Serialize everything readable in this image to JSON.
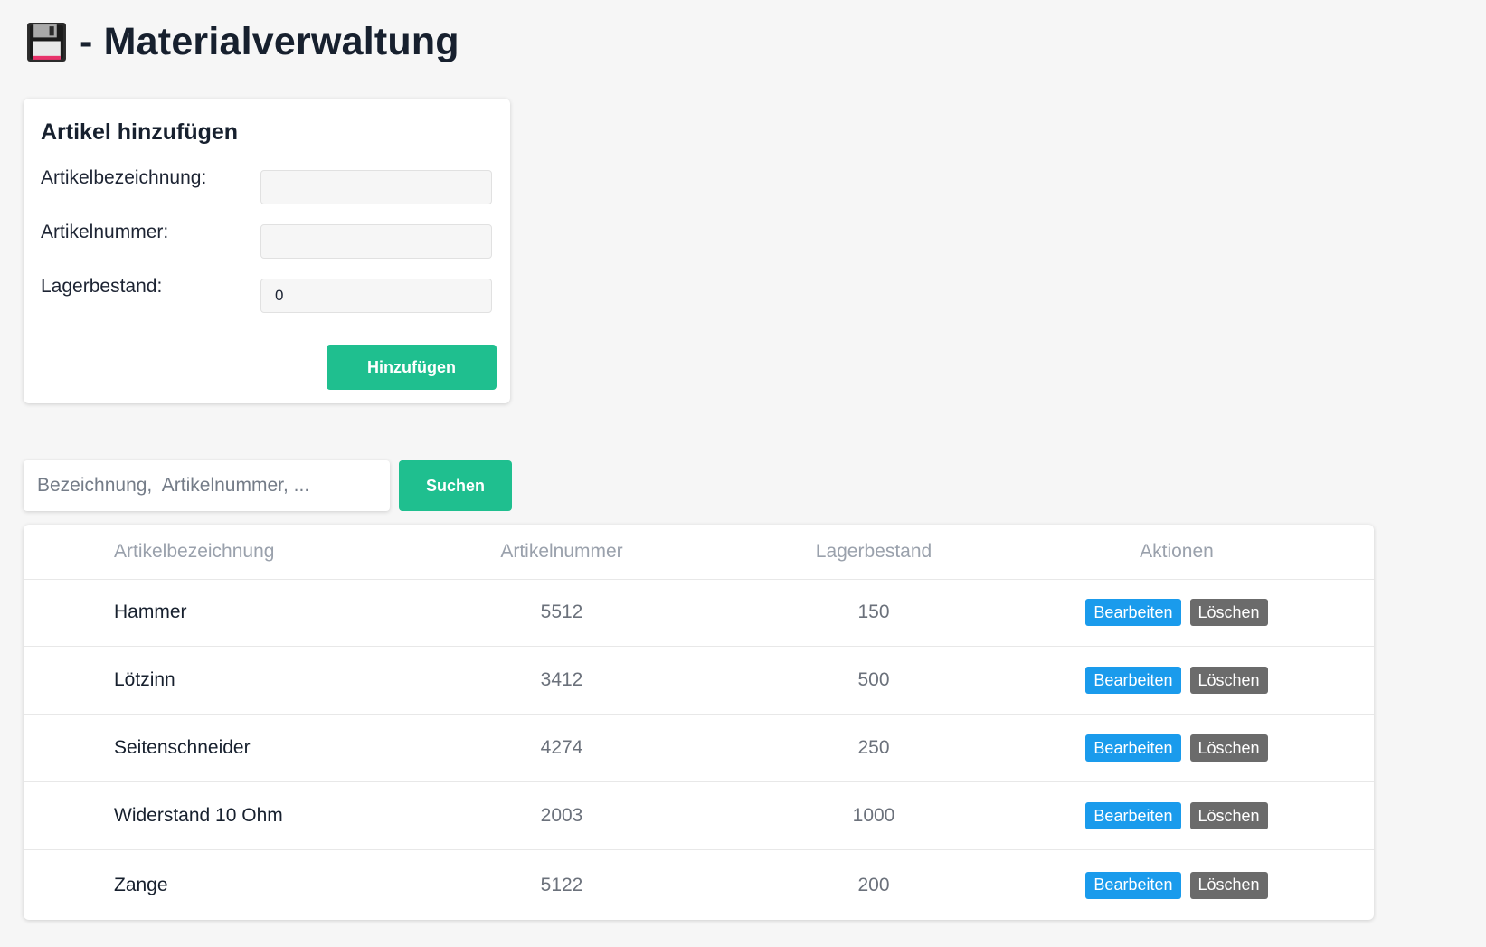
{
  "header": {
    "icon": "floppy-disk-icon",
    "title": "- Materialverwaltung"
  },
  "add_form": {
    "title": "Artikel hinzufügen",
    "fields": [
      {
        "label": "Artikelbezeichnung:",
        "value": "",
        "placeholder": ""
      },
      {
        "label": "Artikelnummer:",
        "value": "",
        "placeholder": ""
      },
      {
        "label": "Lagerbestand:",
        "value": "0",
        "placeholder": ""
      }
    ],
    "submit_label": "Hinzufügen"
  },
  "search": {
    "placeholder": "Bezeichnung,  Artikelnummer, ...",
    "value": "",
    "button_label": "Suchen"
  },
  "table": {
    "headers": [
      "Artikelbezeichnung",
      "Artikelnummer",
      "Lagerbestand",
      "Aktionen"
    ],
    "edit_label": "Bearbeiten",
    "delete_label": "Löschen",
    "rows": [
      {
        "name": "Hammer",
        "number": "5512",
        "stock": "150"
      },
      {
        "name": "Lötzinn",
        "number": "3412",
        "stock": "500"
      },
      {
        "name": "Seitenschneider",
        "number": "4274",
        "stock": "250"
      },
      {
        "name": "Widerstand 10 Ohm",
        "number": "2003",
        "stock": "1000"
      },
      {
        "name": "Zange",
        "number": "5122",
        "stock": "200"
      }
    ]
  },
  "colors": {
    "background": "#f6f6f6",
    "primary_green": "#1fbf8f",
    "edit_blue": "#1a9bec",
    "delete_gray": "#6b6b6b",
    "title_text": "#17202e"
  }
}
